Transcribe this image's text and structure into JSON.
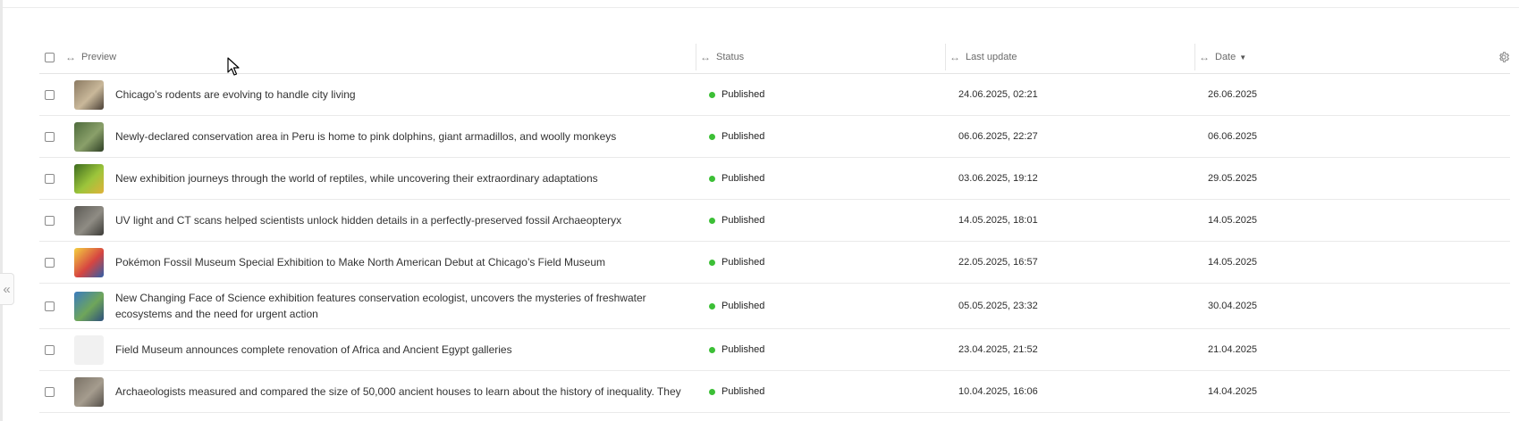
{
  "sidebar": {
    "collapse_glyph": "«"
  },
  "table": {
    "columns": {
      "preview": "Preview",
      "status": "Status",
      "last_update": "Last update",
      "date": "Date"
    },
    "sort": {
      "column": "Date",
      "direction": "descending"
    },
    "rows": [
      {
        "title": "Chicago’s rodents are evolving to handle city living",
        "status": "Published",
        "last_update": "24.06.2025, 02:21",
        "date": "26.06.2025",
        "thumb_icon": "rodent-photo-thumbnail",
        "thumb_colors": [
          "#8b7a62",
          "#c9b89a",
          "#4a4036"
        ]
      },
      {
        "title": "Newly-declared conservation area in Peru is home to pink dolphins, giant armadillos, and woolly monkeys",
        "status": "Published",
        "last_update": "06.06.2025, 22:27",
        "date": "06.06.2025",
        "thumb_icon": "rainforest-photo-thumbnail",
        "thumb_colors": [
          "#4e6b3c",
          "#8aa06a",
          "#2e3f25"
        ]
      },
      {
        "title": "New exhibition journeys through the world of reptiles, while uncovering their extraordinary adaptations",
        "status": "Published",
        "last_update": "03.06.2025, 19:12",
        "date": "29.05.2025",
        "thumb_icon": "chameleon-photo-thumbnail",
        "thumb_colors": [
          "#3d6b1f",
          "#9cc53b",
          "#e0b23a"
        ]
      },
      {
        "title": "UV light and CT scans helped scientists unlock hidden details in a perfectly-preserved fossil Archaeopteryx",
        "status": "Published",
        "last_update": "14.05.2025, 18:01",
        "date": "14.05.2025",
        "thumb_icon": "fossil-photo-thumbnail",
        "thumb_colors": [
          "#5c5a55",
          "#8f8c84",
          "#3b3a36"
        ]
      },
      {
        "title": "Pokémon Fossil Museum Special Exhibition to Make North American Debut at Chicago’s Field Museum",
        "status": "Published",
        "last_update": "22.05.2025, 16:57",
        "date": "14.05.2025",
        "thumb_icon": "pokemon-logo-thumbnail",
        "thumb_colors": [
          "#f4d03f",
          "#d64541",
          "#2e5ea8"
        ]
      },
      {
        "title": "New Changing Face of Science exhibition features conservation ecologist, uncovers the mysteries of freshwater ecosystems and the need for urgent action",
        "status": "Published",
        "last_update": "05.05.2025, 23:32",
        "date": "30.04.2025",
        "thumb_icon": "ecologist-photo-thumbnail",
        "thumb_colors": [
          "#3a7bbf",
          "#6fa65a",
          "#2d4f7c"
        ]
      },
      {
        "title": "Field Museum announces complete renovation of Africa and Ancient Egypt galleries",
        "status": "Published",
        "last_update": "23.04.2025, 21:52",
        "date": "21.04.2025",
        "thumb_icon": "empty-thumbnail",
        "thumb_colors": [
          "#f1f1f1",
          "#f1f1f1",
          "#f1f1f1"
        ]
      },
      {
        "title": "Archaeologists measured and compared the size of 50,000 ancient houses to learn about the history of inequality. They",
        "status": "Published",
        "last_update": "10.04.2025, 16:06",
        "date": "14.04.2025",
        "thumb_icon": "ruins-photo-thumbnail",
        "thumb_colors": [
          "#7a7266",
          "#a59c8e",
          "#55504a"
        ]
      }
    ]
  },
  "colors": {
    "status_published": "#3cbf36",
    "border": "#eaeaea",
    "header_text": "#6b6b6b"
  },
  "icons": {
    "column_resize": "column-resize-icon",
    "sort": "sort-descending-icon",
    "settings": "gear-icon",
    "pointer": "mouse-pointer-icon"
  }
}
